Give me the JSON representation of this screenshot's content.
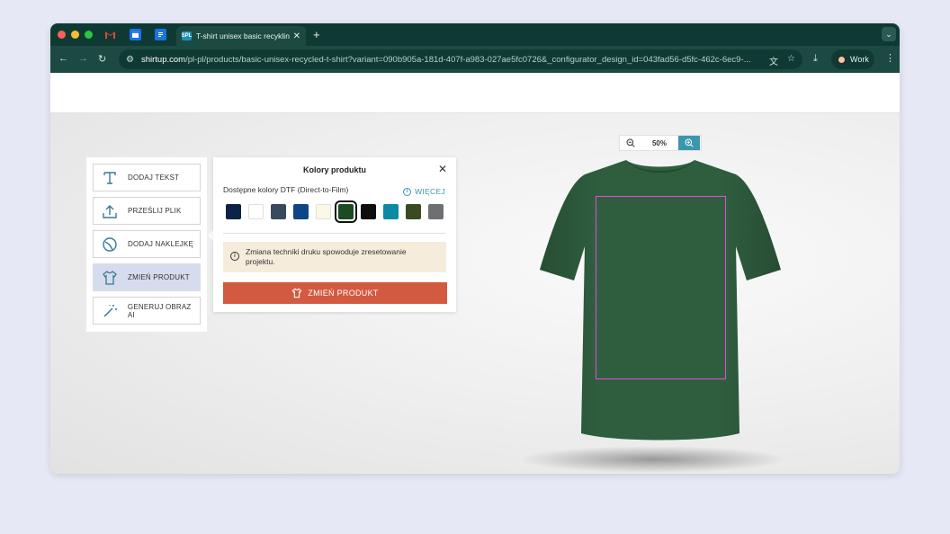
{
  "browser": {
    "pinned_tabs": [
      {
        "name": "gmail",
        "glyph": "M",
        "color": "#d93025"
      },
      {
        "name": "calendar",
        "glyph": "",
        "color": "#1a73e8"
      },
      {
        "name": "forms",
        "glyph": "",
        "color": "#1a73e8"
      }
    ],
    "active_tab": {
      "title": "T-shirt unisex basic recykling",
      "favicon_text": "SPL"
    },
    "url_host": "shirtup.com",
    "url_rest": "/pl-pl/products/basic-unisex-recycled-t-shirt?variant=090b905a-181d-407f-a983-027ae5fc0726&_configurator_design_id=043fad56-d5fc-462c-6ec9-...",
    "profile_label": "Work"
  },
  "tools": [
    {
      "id": "add-text",
      "label": "DODAJ TEKST",
      "icon": "text-icon",
      "active": false
    },
    {
      "id": "upload-file",
      "label": "PRZEŚLIJ PLIK",
      "icon": "upload-icon",
      "active": false
    },
    {
      "id": "add-sticker",
      "label": "DODAJ NAKLEJKĘ",
      "icon": "sticker-icon",
      "active": false
    },
    {
      "id": "change-product",
      "label": "ZMIEŃ PRODUKT",
      "icon": "tshirt-icon",
      "active": true
    },
    {
      "id": "generate-ai",
      "label": "GENERUJ OBRAZ AI",
      "icon": "magic-wand-icon",
      "active": false
    }
  ],
  "panel": {
    "title": "Kolory produktu",
    "dtf_label": "Dostępne kolory DTF (Direct-to-Film)",
    "more_label": "WIĘCEJ",
    "swatches": [
      "#0c2346",
      "#ffffff",
      "#394a5e",
      "#0d4686",
      "#fdf8e6",
      "#1c4a22",
      "#0e0e0e",
      "#0b8aa5",
      "#3c4a24",
      "#6d6f73"
    ],
    "selected_swatch": 5,
    "notice": "Zmiana techniki druku spowoduje zresetowanie projektu.",
    "button_label": "ZMIEŃ PRODUKT"
  },
  "zoom": {
    "value": "50%"
  },
  "product": {
    "shirt_color": "#2f5e3f"
  }
}
